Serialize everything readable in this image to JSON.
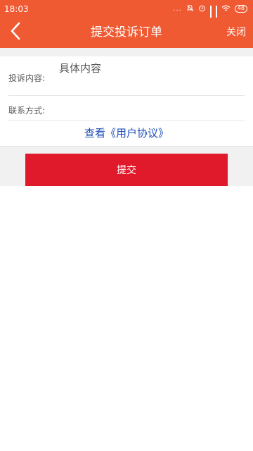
{
  "status_bar": {
    "time": "18:03",
    "dots": "...",
    "battery": "48"
  },
  "nav": {
    "title": "提交投诉订单",
    "close_label": "关闭"
  },
  "form": {
    "content_label": "投诉内容:",
    "content_value": "具体内容",
    "contact_label": "联系方式:",
    "contact_value": "",
    "agreement_link": "查看《用户协议》"
  },
  "submit_label": "提交",
  "colors": {
    "header": "#ef5a33",
    "submit": "#e11a2b",
    "link": "#1c4cb8"
  },
  "icons": {
    "back": "chevron-left-icon",
    "mute": "bell-off-icon",
    "alarm": "alarm-clock-icon",
    "signal": "signal-icon",
    "wifi": "wifi-icon",
    "battery": "battery-icon"
  }
}
